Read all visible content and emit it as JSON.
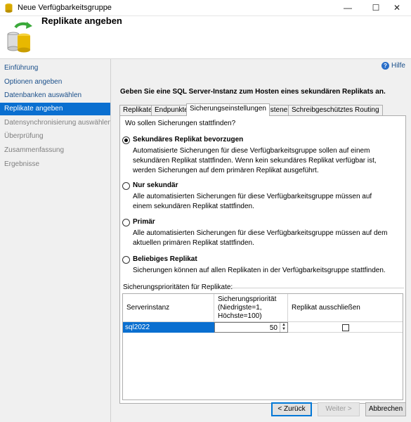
{
  "window": {
    "title": "Neue Verfügbarkeitsgruppe",
    "controls": {
      "minimize": "—",
      "maximize": "☐",
      "close": "✕"
    }
  },
  "header": {
    "title": "Replikate angeben"
  },
  "nav": {
    "items": [
      {
        "label": "Einführung",
        "state": "link"
      },
      {
        "label": "Optionen angeben",
        "state": "link"
      },
      {
        "label": "Datenbanken auswählen",
        "state": "link"
      },
      {
        "label": "Replikate angeben",
        "state": "selected"
      },
      {
        "label": "Datensynchronisierung auswählen",
        "state": "disabled"
      },
      {
        "label": "Überprüfung",
        "state": "disabled"
      },
      {
        "label": "Zusammenfassung",
        "state": "disabled"
      },
      {
        "label": "Ergebnisse",
        "state": "disabled"
      }
    ]
  },
  "help": {
    "label": "Hilfe",
    "icon": "help-icon"
  },
  "main": {
    "prompt": "Geben Sie eine SQL Server-Instanz zum Hosten eines sekundären Replikats an.",
    "tabs": [
      "Replikate",
      "Endpunkte",
      "Sicherungseinstellungen",
      "Listener",
      "Schreibgeschütztes Routing"
    ],
    "active_tab": "Sicherungseinstellungen",
    "question": "Wo sollen Sicherungen stattfinden?",
    "options": [
      {
        "label": "Sekundäres Replikat bevorzugen",
        "checked": true,
        "description": "Automatisierte Sicherungen für diese Verfügbarkeitsgruppe sollen auf einem sekundären Replikat stattfinden. Wenn kein sekundäres Replikat verfügbar ist, werden Sicherungen auf dem primären Replikat ausgeführt."
      },
      {
        "label": "Nur sekundär",
        "checked": false,
        "description": "Alle automatisierten Sicherungen für diese Verfügbarkeitsgruppe müssen auf einem sekundären Replikat stattfinden."
      },
      {
        "label": "Primär",
        "checked": false,
        "description": "Alle automatisierten Sicherungen für diese Verfügbarkeitsgruppe müssen auf dem aktuellen primären Replikat stattfinden."
      },
      {
        "label": "Beliebiges Replikat",
        "checked": false,
        "description": "Sicherungen können auf allen Replikaten in der Verfügbarkeitsgruppe stattfinden."
      }
    ],
    "priority_group_label": "Sicherungsprioritäten für Replikate:",
    "grid": {
      "columns": [
        "Serverinstanz",
        "Sicherungspriorität (Niedrigste=1, Höchste=100)",
        "Replikat ausschließen"
      ],
      "rows": [
        {
          "instance": "sql2022",
          "priority": "50",
          "exclude": false
        }
      ]
    }
  },
  "buttons": {
    "back": "< Zurück",
    "next": "Weiter >",
    "cancel": "Abbrechen"
  },
  "colors": {
    "selection": "#0a6fd0",
    "link": "#1a4f8a",
    "panel_bg": "#f0f0f0"
  }
}
